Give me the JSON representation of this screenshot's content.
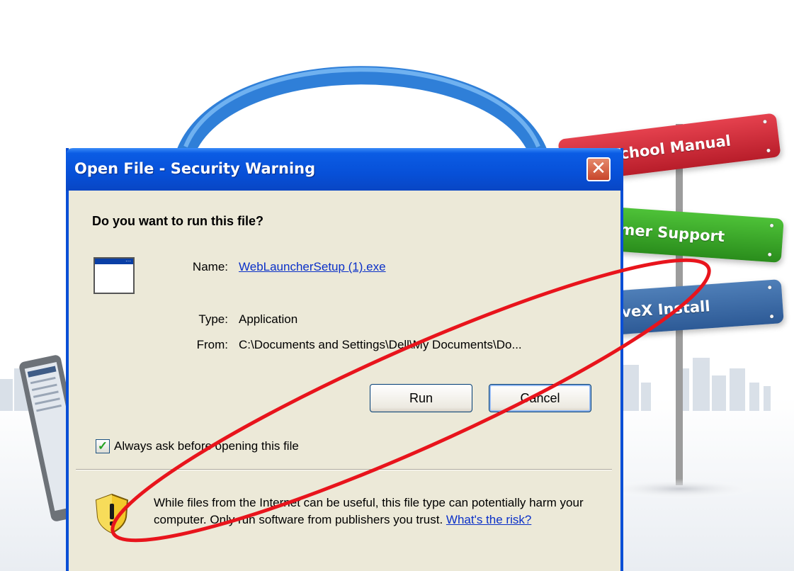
{
  "background": {
    "signs": [
      {
        "text": "School Manual",
        "color": "#d22c39"
      },
      {
        "text": "omer Support",
        "color": "#3aa82a"
      },
      {
        "text": "tiveX Install",
        "color": "#3e6ea8"
      }
    ]
  },
  "dialog": {
    "title": "Open File - Security Warning",
    "close_icon": "close-icon",
    "heading": "Do you want to run this file?",
    "file_icon": "application-window-icon",
    "name_label": "Name:",
    "name_value": "WebLauncherSetup (1).exe",
    "type_label": "Type:",
    "type_value": "Application",
    "from_label": "From:",
    "from_value": "C:\\Documents and Settings\\Dell\\My Documents\\Do...",
    "run_button": "Run",
    "cancel_button": "Cancel",
    "always_ask_label": "Always ask before opening this file",
    "always_ask_checked": true,
    "warning_icon": "shield-warning-icon",
    "warning_text": "While files from the Internet can be useful, this file type can potentially harm your computer. Only run software from publishers you trust.",
    "risk_link": "What's the risk?"
  },
  "colors": {
    "titlebar": "#0750d8",
    "dialog_bg": "#ece9d8",
    "link": "#0a30c8",
    "annotation": "#e8141c"
  }
}
